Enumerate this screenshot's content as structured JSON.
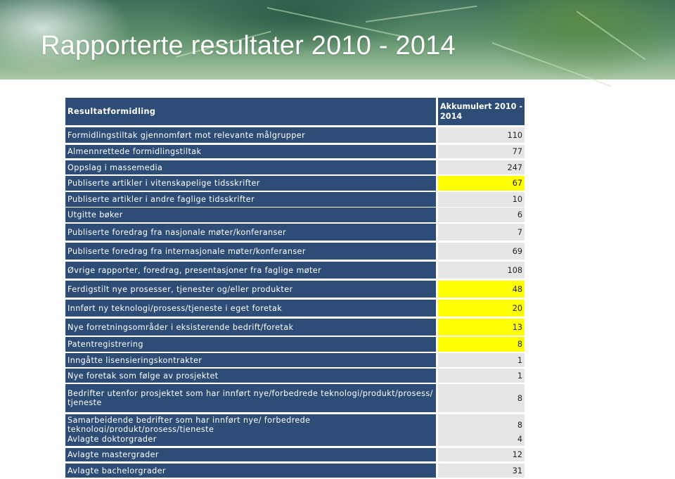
{
  "title": "Rapporterte resultater 2010 - 2014",
  "table": {
    "header_label": "Resultatformidling",
    "header_value": "Akkumulert 2010 - 2014",
    "highlight_color": "#ffff00",
    "header_color": "#2d4d76",
    "rows": [
      {
        "label": "Formidlingstiltak gjennomført mot relevante målgrupper",
        "value": "110",
        "highlight": false
      },
      {
        "label": "Almennrettede formidlingstiltak",
        "value": "77",
        "highlight": false
      },
      {
        "label": "Oppslag i massemedia",
        "value": "247",
        "highlight": false
      },
      {
        "label": "Publiserte artikler i vitenskapelige tidsskrifter",
        "value": "67",
        "highlight": true
      },
      {
        "label": "Publiserte artikler i andre faglige tidsskrifter",
        "value": "10",
        "highlight": false
      },
      {
        "label": "Utgitte bøker",
        "value": "6",
        "highlight": false
      },
      {
        "label": "Publiserte foredrag fra nasjonale møter/konferanser",
        "value": "7",
        "highlight": false
      },
      {
        "label": "Publiserte foredrag fra internasjonale møter/konferanser",
        "value": "69",
        "highlight": false
      },
      {
        "label": "Øvrige rapporter, foredrag, presentasjoner fra faglige møter",
        "value": "108",
        "highlight": false
      },
      {
        "label": "Ferdigstilt nye prosesser, tjenester og/eller produkter",
        "value": "48",
        "highlight": true
      },
      {
        "label": "Innført ny teknologi/prosess/tjeneste i eget foretak",
        "value": "20",
        "highlight": true
      },
      {
        "label": "Nye forretningsområder i eksisterende bedrift/foretak",
        "value": "13",
        "highlight": true
      },
      {
        "label": "Patentregistrering",
        "value": "8",
        "highlight": true
      },
      {
        "label": "Inngåtte lisensieringskontrakter",
        "value": "1",
        "highlight": false
      },
      {
        "label": "Nye foretak som følge av prosjektet",
        "value": "1",
        "highlight": false
      },
      {
        "label": "Bedrifter utenfor prosjektet som har innført nye/forbedrede teknologi/produkt/prosess/ tjeneste",
        "value": "8",
        "highlight": false
      },
      {
        "label": "Samarbeidende bedrifter som har innført nye/ forbedrede teknologi/produkt/prosess/tjeneste",
        "value": "8",
        "highlight": false
      },
      {
        "label": "Avlagte doktorgrader",
        "value": "4",
        "highlight": false
      },
      {
        "label": "Avlagte mastergrader",
        "value": "12",
        "highlight": false
      },
      {
        "label": "Avlagte bachelorgrader",
        "value": "31",
        "highlight": false
      }
    ]
  }
}
